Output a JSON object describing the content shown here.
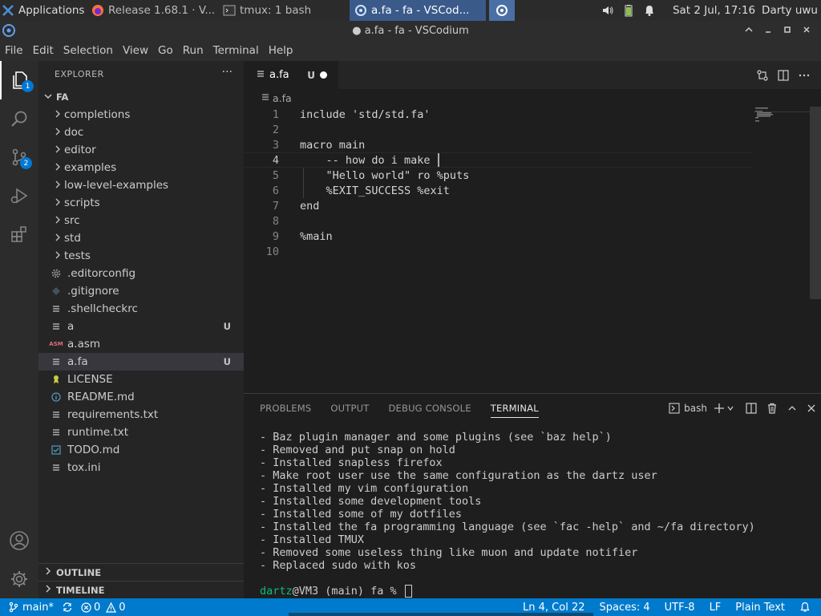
{
  "desktop_panel": {
    "apps_label": "Applications",
    "tasks": [
      {
        "label": "Release 1.68.1 · V..."
      },
      {
        "label": "tmux: 1 bash"
      },
      {
        "label": "a.fa - fa - VSCod..."
      }
    ],
    "clock": "Sat  2 Jul, 17:16",
    "user": "Darty uwu"
  },
  "window": {
    "title": "● a.fa - fa - VSCodium"
  },
  "menu": {
    "items": [
      "File",
      "Edit",
      "Selection",
      "View",
      "Go",
      "Run",
      "Terminal",
      "Help"
    ]
  },
  "activity": {
    "explorer_badge": "1",
    "scm_badge": "2"
  },
  "sidebar": {
    "title": "EXPLORER",
    "more": "···",
    "folder": "FA",
    "items": [
      {
        "name": "completions",
        "type": "folder",
        "git": ""
      },
      {
        "name": "doc",
        "type": "folder",
        "git": ""
      },
      {
        "name": "editor",
        "type": "folder",
        "git": ""
      },
      {
        "name": "examples",
        "type": "folder",
        "git": ""
      },
      {
        "name": "low-level-examples",
        "type": "folder",
        "git": ""
      },
      {
        "name": "scripts",
        "type": "folder",
        "git": ""
      },
      {
        "name": "src",
        "type": "folder",
        "git": ""
      },
      {
        "name": "std",
        "type": "folder",
        "git": ""
      },
      {
        "name": "tests",
        "type": "folder",
        "git": ""
      },
      {
        "name": ".editorconfig",
        "type": "gear",
        "git": ""
      },
      {
        "name": ".gitignore",
        "type": "git",
        "git": ""
      },
      {
        "name": ".shellcheckrc",
        "type": "lines",
        "git": ""
      },
      {
        "name": "a",
        "type": "lines",
        "git": "U"
      },
      {
        "name": "a.asm",
        "type": "asm",
        "git": ""
      },
      {
        "name": "a.fa",
        "type": "lines",
        "git": "U"
      },
      {
        "name": "LICENSE",
        "type": "license",
        "git": ""
      },
      {
        "name": "README.md",
        "type": "info",
        "git": ""
      },
      {
        "name": "requirements.txt",
        "type": "lines",
        "git": ""
      },
      {
        "name": "runtime.txt",
        "type": "lines",
        "git": ""
      },
      {
        "name": "TODO.md",
        "type": "check",
        "git": ""
      },
      {
        "name": "tox.ini",
        "type": "lines",
        "git": ""
      }
    ],
    "outline": "OUTLINE",
    "timeline": "TIMELINE"
  },
  "editor": {
    "tab": {
      "label": "a.fa",
      "state": "U"
    },
    "breadcrumb": "a.fa",
    "lines": [
      {
        "n": "1",
        "text": "include 'std/std.fa'"
      },
      {
        "n": "2",
        "text": ""
      },
      {
        "n": "3",
        "text": "macro main"
      },
      {
        "n": "4",
        "text": "    -- how do i make "
      },
      {
        "n": "5",
        "text": "    \"Hello world\" ro %puts"
      },
      {
        "n": "6",
        "text": "    %EXIT_SUCCESS %exit"
      },
      {
        "n": "7",
        "text": "end"
      },
      {
        "n": "8",
        "text": ""
      },
      {
        "n": "9",
        "text": "%main"
      },
      {
        "n": "10",
        "text": ""
      }
    ]
  },
  "panel": {
    "tabs": [
      "PROBLEMS",
      "OUTPUT",
      "DEBUG CONSOLE",
      "TERMINAL"
    ],
    "shell": "bash",
    "terminal_lines": [
      "- Baz plugin manager and some plugins (see `baz help`)",
      "- Removed and put snap on hold",
      "- Installed snapless firefox",
      "- Make root user use the same configuration as the dartz user",
      "- Installed my vim configuration",
      "- Installed some development tools",
      "- Installed some of my dotfiles",
      "- Installed the fa programming language (see `fac -help` and ~/fa directory)",
      "- Installed TMUX",
      "- Removed some useless thing like muon and update notifier",
      "- Replaced sudo with kos"
    ],
    "prompt_user": "dartz",
    "prompt_rest": "@VM3 (main) fa % "
  },
  "status": {
    "branch": "main*",
    "errors": "0",
    "warnings": "0",
    "position": "Ln 4, Col 22",
    "spaces": "Spaces: 4",
    "encoding": "UTF-8",
    "eol": "LF",
    "language": "Plain Text"
  },
  "colors": {
    "statusbar": "#007acc",
    "badge": "#0078d4",
    "prompt_user": "#0dbc79"
  }
}
